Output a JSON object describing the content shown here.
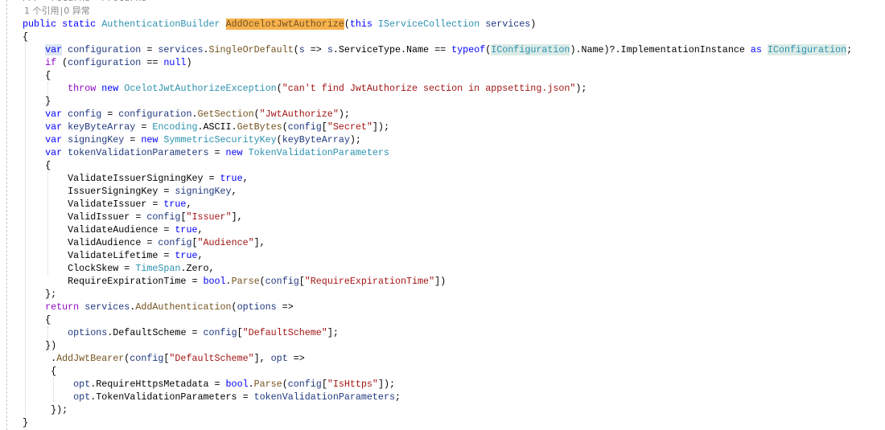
{
  "colors": {
    "keyword": "#0000ff",
    "control": "#8f08c4",
    "type": "#2b91af",
    "method": "#74531f",
    "identifier": "#1f377f",
    "string": "#a31515",
    "comment": "#808080",
    "definition_highlight": "#f7b24d"
  },
  "codelens": {
    "references": "1 个引用",
    "separator": "|",
    "exceptions": "0 异常"
  },
  "lines": [
    {
      "indent": 0,
      "tokens": [
        [
          "/// <returns></returns>",
          "g"
        ]
      ]
    },
    {
      "codelens": true
    },
    {
      "indent": 0,
      "tokens": [
        [
          "public",
          "k"
        ],
        [
          " ",
          "p"
        ],
        [
          "static",
          "k"
        ],
        [
          " ",
          "p"
        ],
        [
          "AuthenticationBuilder",
          "t"
        ],
        [
          " ",
          "p"
        ],
        [
          "AddOcelotJwtAuthorize",
          "m hl-def"
        ],
        [
          "(",
          "p"
        ],
        [
          "this",
          "k"
        ],
        [
          " ",
          "p"
        ],
        [
          "IServiceCollection",
          "t"
        ],
        [
          " ",
          "p"
        ],
        [
          "services",
          "v"
        ],
        [
          ")",
          "p"
        ]
      ]
    },
    {
      "indent": 0,
      "tokens": [
        [
          "{",
          "p"
        ]
      ]
    },
    {
      "indent": 4,
      "tokens": [
        [
          "var",
          "k hl-var"
        ],
        [
          " ",
          "p"
        ],
        [
          "configuration",
          "v"
        ],
        [
          " = ",
          "p"
        ],
        [
          "services",
          "v"
        ],
        [
          ".",
          "p"
        ],
        [
          "SingleOrDefault",
          "m"
        ],
        [
          "(",
          "p"
        ],
        [
          "s",
          "v"
        ],
        [
          " => ",
          "p"
        ],
        [
          "s",
          "v"
        ],
        [
          ".ServiceType.Name == ",
          "p"
        ],
        [
          "typeof",
          "k"
        ],
        [
          "(",
          "p"
        ],
        [
          "IConfiguration",
          "t hl-ref"
        ],
        [
          ").Name)?.ImplementationInstance ",
          "p"
        ],
        [
          "as",
          "k"
        ],
        [
          " ",
          "p"
        ],
        [
          "IConfiguration",
          "t hl-ref"
        ],
        [
          ";",
          "p"
        ]
      ]
    },
    {
      "indent": 4,
      "tokens": [
        [
          "if",
          "c"
        ],
        [
          " (",
          "p"
        ],
        [
          "configuration",
          "v"
        ],
        [
          " == ",
          "p"
        ],
        [
          "null",
          "k"
        ],
        [
          ")",
          "p"
        ]
      ]
    },
    {
      "indent": 4,
      "tokens": [
        [
          "{",
          "p"
        ]
      ]
    },
    {
      "indent": 8,
      "tokens": [
        [
          "throw",
          "c"
        ],
        [
          " ",
          "p"
        ],
        [
          "new",
          "k"
        ],
        [
          " ",
          "p"
        ],
        [
          "OcelotJwtAuthorizeException",
          "t"
        ],
        [
          "(",
          "p"
        ],
        [
          "\"can't find JwtAuthorize section in appsetting.json\"",
          "s"
        ],
        [
          ");",
          "p"
        ]
      ]
    },
    {
      "indent": 4,
      "tokens": [
        [
          "}",
          "p"
        ]
      ]
    },
    {
      "indent": 4,
      "tokens": [
        [
          "var",
          "k"
        ],
        [
          " ",
          "p"
        ],
        [
          "config",
          "v"
        ],
        [
          " = ",
          "p"
        ],
        [
          "configuration",
          "v"
        ],
        [
          ".",
          "p"
        ],
        [
          "GetSection",
          "m"
        ],
        [
          "(",
          "p"
        ],
        [
          "\"JwtAuthorize\"",
          "s"
        ],
        [
          ");",
          "p"
        ]
      ]
    },
    {
      "indent": 4,
      "tokens": [
        [
          "var",
          "k"
        ],
        [
          " ",
          "p"
        ],
        [
          "keyByteArray",
          "v"
        ],
        [
          " = ",
          "p"
        ],
        [
          "Encoding",
          "t"
        ],
        [
          ".ASCII.",
          "p"
        ],
        [
          "GetBytes",
          "m"
        ],
        [
          "(",
          "p"
        ],
        [
          "config",
          "v"
        ],
        [
          "[",
          "p"
        ],
        [
          "\"Secret\"",
          "s"
        ],
        [
          "]);",
          "p"
        ]
      ]
    },
    {
      "indent": 4,
      "tokens": [
        [
          "var",
          "k"
        ],
        [
          " ",
          "p"
        ],
        [
          "signingKey",
          "v"
        ],
        [
          " = ",
          "p"
        ],
        [
          "new",
          "k"
        ],
        [
          " ",
          "p"
        ],
        [
          "SymmetricSecurityKey",
          "t"
        ],
        [
          "(",
          "p"
        ],
        [
          "keyByteArray",
          "v"
        ],
        [
          ");",
          "p"
        ]
      ]
    },
    {
      "indent": 4,
      "tokens": [
        [
          "var",
          "k"
        ],
        [
          " ",
          "p"
        ],
        [
          "tokenValidationParameters",
          "v"
        ],
        [
          " = ",
          "p"
        ],
        [
          "new",
          "k"
        ],
        [
          " ",
          "p"
        ],
        [
          "TokenValidationParameters",
          "t"
        ]
      ]
    },
    {
      "indent": 4,
      "tokens": [
        [
          "{",
          "p"
        ]
      ]
    },
    {
      "indent": 8,
      "tokens": [
        [
          "ValidateIssuerSigningKey = ",
          "p"
        ],
        [
          "true",
          "k"
        ],
        [
          ",",
          "p"
        ]
      ]
    },
    {
      "indent": 8,
      "tokens": [
        [
          "IssuerSigningKey = ",
          "p"
        ],
        [
          "signingKey",
          "v"
        ],
        [
          ",",
          "p"
        ]
      ]
    },
    {
      "indent": 8,
      "tokens": [
        [
          "ValidateIssuer = ",
          "p"
        ],
        [
          "true",
          "k"
        ],
        [
          ",",
          "p"
        ]
      ]
    },
    {
      "indent": 8,
      "tokens": [
        [
          "ValidIssuer = ",
          "p"
        ],
        [
          "config",
          "v"
        ],
        [
          "[",
          "p"
        ],
        [
          "\"Issuer\"",
          "s"
        ],
        [
          "],",
          "p"
        ]
      ]
    },
    {
      "indent": 8,
      "tokens": [
        [
          "ValidateAudience = ",
          "p"
        ],
        [
          "true",
          "k"
        ],
        [
          ",",
          "p"
        ]
      ]
    },
    {
      "indent": 8,
      "tokens": [
        [
          "ValidAudience = ",
          "p"
        ],
        [
          "config",
          "v"
        ],
        [
          "[",
          "p"
        ],
        [
          "\"Audience\"",
          "s"
        ],
        [
          "],",
          "p"
        ]
      ]
    },
    {
      "indent": 8,
      "tokens": [
        [
          "ValidateLifetime = ",
          "p"
        ],
        [
          "true",
          "k"
        ],
        [
          ",",
          "p"
        ]
      ]
    },
    {
      "indent": 8,
      "tokens": [
        [
          "ClockSkew = ",
          "p"
        ],
        [
          "TimeSpan",
          "t"
        ],
        [
          ".Zero,",
          "p"
        ]
      ]
    },
    {
      "indent": 8,
      "tokens": [
        [
          "RequireExpirationTime = ",
          "p"
        ],
        [
          "bool",
          "k"
        ],
        [
          ".",
          "p"
        ],
        [
          "Parse",
          "m"
        ],
        [
          "(",
          "p"
        ],
        [
          "config",
          "v"
        ],
        [
          "[",
          "p"
        ],
        [
          "\"RequireExpirationTime\"",
          "s"
        ],
        [
          "])",
          "p"
        ]
      ]
    },
    {
      "indent": 4,
      "tokens": [
        [
          "};",
          "p"
        ]
      ]
    },
    {
      "indent": 4,
      "tokens": [
        [
          "return",
          "c"
        ],
        [
          " ",
          "p"
        ],
        [
          "services",
          "v"
        ],
        [
          ".",
          "p"
        ],
        [
          "AddAuthentication",
          "m"
        ],
        [
          "(",
          "p"
        ],
        [
          "options",
          "v"
        ],
        [
          " =>",
          "p"
        ]
      ]
    },
    {
      "indent": 4,
      "tokens": [
        [
          "{",
          "p"
        ]
      ]
    },
    {
      "indent": 8,
      "tokens": [
        [
          "options",
          "v"
        ],
        [
          ".DefaultScheme = ",
          "p"
        ],
        [
          "config",
          "v"
        ],
        [
          "[",
          "p"
        ],
        [
          "\"DefaultScheme\"",
          "s"
        ],
        [
          "];",
          "p"
        ]
      ]
    },
    {
      "indent": 4,
      "tokens": [
        [
          "})",
          "p"
        ]
      ]
    },
    {
      "indent": 5,
      "tokens": [
        [
          ".",
          "p"
        ],
        [
          "AddJwtBearer",
          "m"
        ],
        [
          "(",
          "p"
        ],
        [
          "config",
          "v"
        ],
        [
          "[",
          "p"
        ],
        [
          "\"DefaultScheme\"",
          "s"
        ],
        [
          "], ",
          "p"
        ],
        [
          "opt",
          "v"
        ],
        [
          " =>",
          "p"
        ]
      ]
    },
    {
      "indent": 5,
      "tokens": [
        [
          "{",
          "p"
        ]
      ]
    },
    {
      "indent": 9,
      "tokens": [
        [
          "opt",
          "v"
        ],
        [
          ".RequireHttpsMetadata = ",
          "p"
        ],
        [
          "bool",
          "k"
        ],
        [
          ".",
          "p"
        ],
        [
          "Parse",
          "m"
        ],
        [
          "(",
          "p"
        ],
        [
          "config",
          "v"
        ],
        [
          "[",
          "p"
        ],
        [
          "\"IsHttps\"",
          "s"
        ],
        [
          "]);",
          "p"
        ]
      ]
    },
    {
      "indent": 9,
      "tokens": [
        [
          "opt",
          "v"
        ],
        [
          ".TokenValidationParameters = ",
          "p"
        ],
        [
          "tokenValidationParameters",
          "v"
        ],
        [
          ";",
          "p"
        ]
      ]
    },
    {
      "indent": 5,
      "tokens": [
        [
          "});",
          "p"
        ]
      ]
    },
    {
      "indent": 0,
      "tokens": [
        [
          "}",
          "p"
        ]
      ]
    }
  ]
}
